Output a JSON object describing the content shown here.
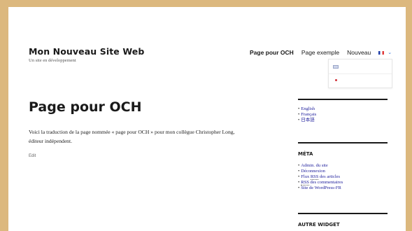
{
  "site": {
    "title": "Mon Nouveau Site Web",
    "description": "Un site en développement"
  },
  "nav": {
    "items": [
      {
        "label": "Page pour OCH",
        "current": true
      },
      {
        "label": "Page exemple",
        "current": false
      },
      {
        "label": "Nouveau",
        "current": false
      }
    ],
    "language": {
      "current_flag": "flag-fr-icon",
      "dropdown_options": [
        "flag-gb-icon",
        "flag-jp-icon"
      ]
    }
  },
  "main": {
    "heading": "Page pour OCH",
    "text_line1": "Voici la traduction de la page  nommée  « page pour OCH » pour mon collègue Christopher Long,",
    "text_line2": "éditeur indépendent.",
    "edit_label": "Edit"
  },
  "sidebar": {
    "languages": [
      "English",
      "Français",
      "日本語"
    ],
    "meta": {
      "title": "MÉTA",
      "items": {
        "admin": "Admin. du site",
        "logout": "Déconnexion",
        "feed_prefix": "Flux ",
        "rss": "RSS",
        "feed_suffix": " des articles",
        "comments_suffix": " des commentaires",
        "wordpress": "Site de WordPress-FR"
      }
    },
    "other_widget_title": "AUTRE WIDGET"
  },
  "colors": {
    "background": "#dcb87e",
    "link": "#1a1a9a",
    "chevron": "#2a6fdb"
  }
}
